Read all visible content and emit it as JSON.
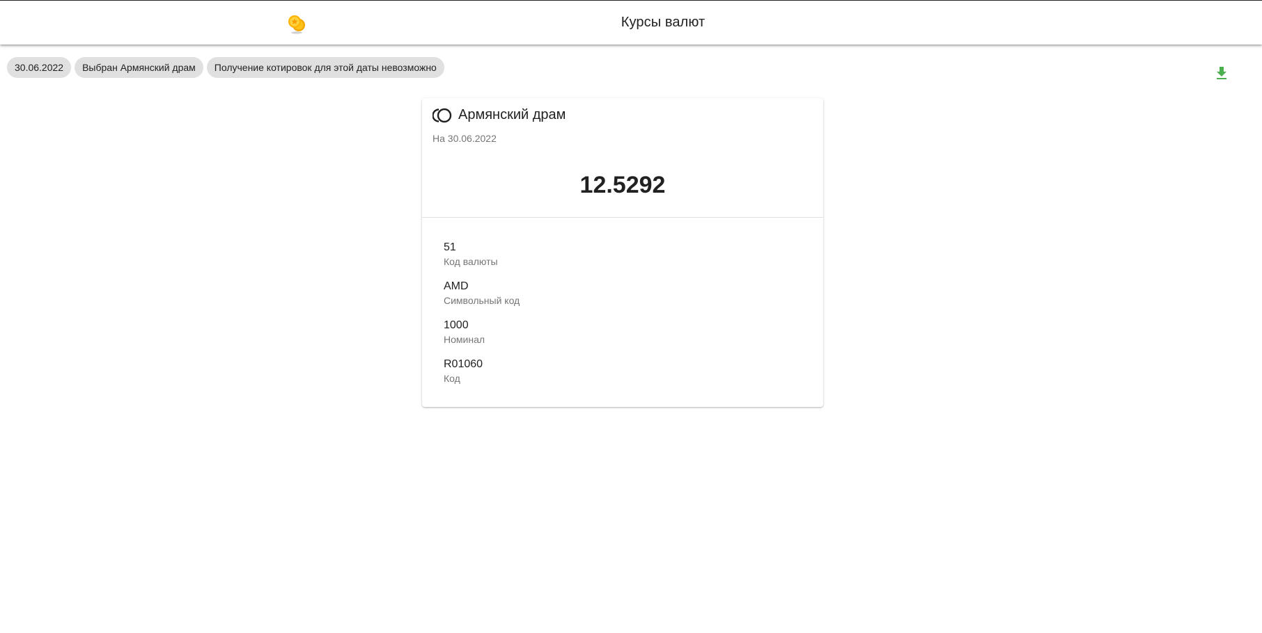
{
  "header": {
    "title": "Курсы валют",
    "logo_icon": "gold-coins-icon"
  },
  "chips": [
    {
      "label": "30.06.2022"
    },
    {
      "label": "Выбран Армянский драм"
    },
    {
      "label": "Получение котировок для этой даты невозможно"
    }
  ],
  "toolbar": {
    "download_icon": "download-icon",
    "accent_color": "#4caf50"
  },
  "card": {
    "icon": "coins-outline-icon",
    "title": "Армянский драм",
    "subtitle": "На 30.06.2022",
    "rate": "12.5292",
    "details": [
      {
        "value": "51",
        "label": "Код валюты"
      },
      {
        "value": "AMD",
        "label": "Символьный код"
      },
      {
        "value": "1000",
        "label": "Номинал"
      },
      {
        "value": "R01060",
        "label": "Код"
      }
    ]
  }
}
